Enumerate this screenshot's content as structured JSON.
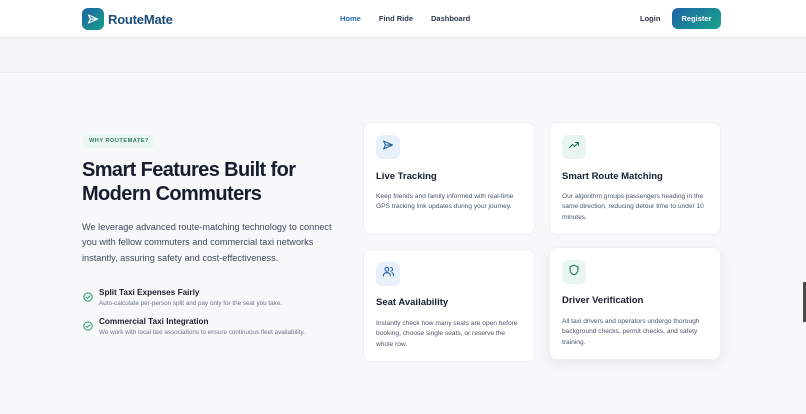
{
  "brand": {
    "name": "RouteMate",
    "accent": "#1f6bb5",
    "accent2": "#17a38c"
  },
  "nav": {
    "links": [
      {
        "label": "Home",
        "active": true
      },
      {
        "label": "Find Ride",
        "active": false
      },
      {
        "label": "Dashboard",
        "active": false
      }
    ],
    "login_label": "Login",
    "register_label": "Register"
  },
  "hero": {
    "badge": "WHY ROUTEMATE?",
    "headline_line1": "Smart Features Built for",
    "headline_line2": "Modern Commuters",
    "lead": "We leverage advanced route-matching technology to connect you with fellow commuters and commercial taxi networks instantly, assuring safety and cost-effectiveness."
  },
  "bullets": [
    {
      "title": "Split Taxi Expenses Fairly",
      "desc": "Auto-calculate per-person split and pay only for the seat you take.",
      "icon": "check-circle-icon"
    },
    {
      "title": "Commercial Taxi Integration",
      "desc": "We work with local taxi associations to ensure continuous fleet availability.",
      "icon": "check-circle-icon"
    }
  ],
  "features": [
    {
      "title": "Live Tracking",
      "desc": "Keep friends and family informed with real-time GPS tracking link updates during your journey.",
      "icon": "send-icon",
      "icon_bg": "#e8f0fa",
      "icon_color": "#1f5f9e"
    },
    {
      "title": "Smart Route Matching",
      "desc": "Our algorithm groups passengers heading in the same direction, reducing detour time to under 10 minutes.",
      "icon": "trending-up-icon",
      "icon_bg": "#e8f6ef",
      "icon_color": "#1f7a55"
    },
    {
      "title": "Seat Availability",
      "desc": "Instantly check how many seats are open before booking, choose single seats, or reserve the whole row.",
      "icon": "users-icon",
      "icon_bg": "#e8f0fa",
      "icon_color": "#1f5f9e"
    },
    {
      "title": "Driver Verification",
      "desc": "All taxi drivers and operators undergo thorough background checks, permit checks, and safety training.",
      "icon": "shield-icon",
      "icon_bg": "#e8f6ef",
      "icon_color": "#1f7a55"
    }
  ]
}
